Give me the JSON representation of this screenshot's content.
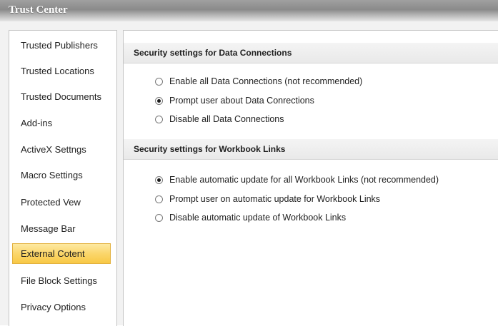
{
  "window": {
    "title": "Trust Center"
  },
  "sidebar": {
    "items": [
      {
        "label": "Trusted Publishers"
      },
      {
        "label": "Trusted Locations"
      },
      {
        "label": "Trusted Documents"
      },
      {
        "label": "Add-ins"
      },
      {
        "label": "ActiveX Settngs"
      },
      {
        "label": "Macro Settings"
      },
      {
        "label": "Protected Vew"
      },
      {
        "label": "Message Bar"
      },
      {
        "label": "External Cotent"
      },
      {
        "label": "File Block Settings"
      },
      {
        "label": "Privacy Options"
      }
    ],
    "selected": "External Cotent"
  },
  "sections": {
    "data_connections": {
      "header": "Security settings for Data Connections",
      "options": [
        {
          "label": "Enable all Data Connections (not recommended)",
          "checked": false
        },
        {
          "label": "Prompt user about Data Conrections",
          "checked": true
        },
        {
          "label": "Disable all Data Connections",
          "checked": false
        }
      ]
    },
    "workbook_links": {
      "header": "Security settings for Workbook Links",
      "options": [
        {
          "label": "Enable automatic update for all Workbook Links (not recommended)",
          "checked": true
        },
        {
          "label": "Prompt user on automatic update for Workbook Links",
          "checked": false
        },
        {
          "label": "Disable automatic update of Workbook Links",
          "checked": false
        }
      ]
    }
  }
}
